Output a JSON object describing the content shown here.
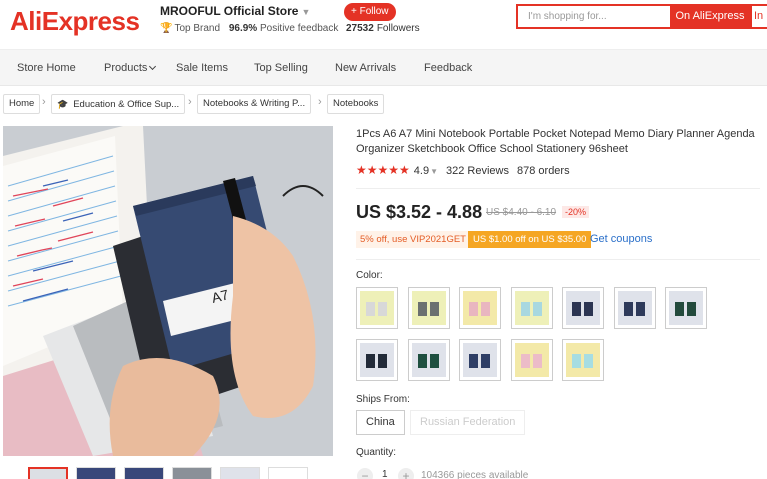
{
  "header": {
    "logo": "AliExpress",
    "store_name": "MROOFUL Official Store",
    "store_tag": "Top Brand",
    "feedback_pct": "96.9%",
    "feedback_label": "Positive feedback",
    "follow_label": "+ Follow",
    "followers_count": "27532",
    "followers_label": "Followers",
    "search_placeholder": "I'm shopping for...",
    "search_button": "On AliExpress",
    "search_button2": "In"
  },
  "nav": {
    "items": [
      "Store Home",
      "Products",
      "Sale Items",
      "Top Selling",
      "New Arrivals",
      "Feedback"
    ]
  },
  "breadcrumb": [
    "Home",
    "Education & Office Sup...",
    "Notebooks & Writing P...",
    "Notebooks"
  ],
  "product": {
    "title": "1Pcs A6 A7 Mini Notebook Portable Pocket Notepad Memo Diary Planner Agenda Organizer Sketchbook Office School Stationery 96sheet",
    "rating": "4.9",
    "reviews": "322 Reviews",
    "orders": "878 orders",
    "price": "US $3.52 - 4.88",
    "old_price": "US $4.40 - 6.10",
    "discount": "-20%",
    "coupon1": "5% off, use VIP2021GET",
    "coupon2": "US $1.00 off on US $35.00",
    "get_coupons": "Get coupons",
    "color_label": "Color:",
    "ships_label": "Ships From:",
    "ships_options": [
      "China",
      "Russian Federation"
    ],
    "quantity_label": "Quantity:",
    "quantity_value": "1",
    "quantity_available": "104366 pieces available",
    "cover_text": "A7"
  },
  "swatch_colors": [
    {
      "bg": "#eef0b8",
      "book": "#d8d8d8"
    },
    {
      "bg": "#eef0b8",
      "book": "#6b7070"
    },
    {
      "bg": "#f3e9a8",
      "book": "#e9b6c0"
    },
    {
      "bg": "#eef0b8",
      "book": "#a8d8e0"
    },
    {
      "bg": "#dfe2ea",
      "book": "#2c3552"
    },
    {
      "bg": "#dfe2ea",
      "book": "#2e3a5a"
    },
    {
      "bg": "#dfe2ea",
      "book": "#234a3c"
    },
    {
      "bg": "#dfe2ea",
      "book": "#222a38"
    },
    {
      "bg": "#dfe2ea",
      "book": "#1f5040"
    },
    {
      "bg": "#dfe2ea",
      "book": "#2e3e66"
    },
    {
      "bg": "#f3e9a8",
      "book": "#ecbcc8"
    },
    {
      "bg": "#f3e9a8",
      "book": "#a6dde2"
    }
  ],
  "accent": "#e43225"
}
